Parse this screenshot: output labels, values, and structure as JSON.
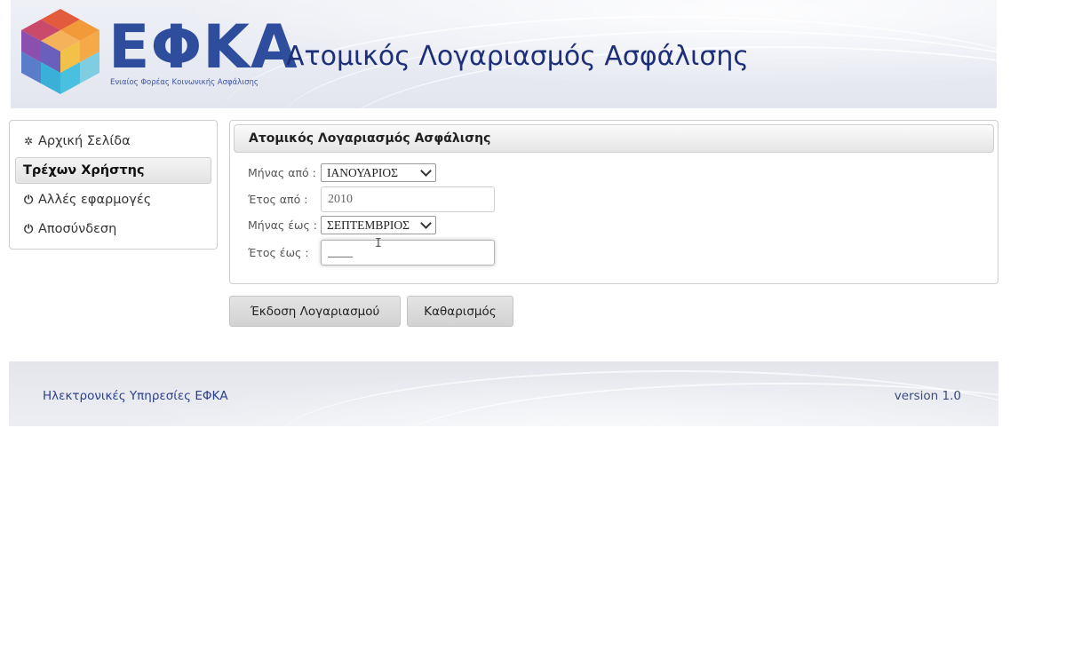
{
  "header": {
    "brand": "ΕΦΚΑ",
    "brand_subtitle": "Ενιαίος Φορέας Κοινωνικής Ασφάλισης",
    "title": "Ατομικός Λογαριασμός Ασφάλισης",
    "logo_colors": [
      "#e25b3c",
      "#f29a3a",
      "#8b4fae",
      "#5b7cc9",
      "#3ab0d8",
      "#f2c14a"
    ]
  },
  "sidebar": {
    "items": [
      {
        "label": "Αρχική Σελίδα",
        "icon": "gear-icon",
        "active": false
      },
      {
        "label": "Τρέχων Χρήστης",
        "icon": "",
        "active": true
      },
      {
        "label": "Αλλές εφαρμογές",
        "icon": "power-icon",
        "active": false
      },
      {
        "label": "Αποσύνδεση",
        "icon": "power-icon",
        "active": false
      }
    ]
  },
  "panel": {
    "title": "Ατομικός Λογαριασμός Ασφάλισης",
    "fields": {
      "month_from": {
        "label": "Μήνας από :",
        "value": "ΙΑΝΟΥΑΡΙΟΣ"
      },
      "year_from": {
        "label": "Έτος από :",
        "value": "2010"
      },
      "month_to": {
        "label": "Μήνας έως :",
        "value": "ΣΕΠΤΕΜΒΡΙΟΣ"
      },
      "year_to": {
        "label": "Έτος έως :",
        "value": "____"
      }
    }
  },
  "buttons": {
    "issue": "Έκδοση Λογαριασμού",
    "clear": "Καθαρισμός"
  },
  "footer": {
    "left": "Ηλεκτρονικές Υπηρεσίες ΕΦΚΑ",
    "right": "version 1.0"
  }
}
